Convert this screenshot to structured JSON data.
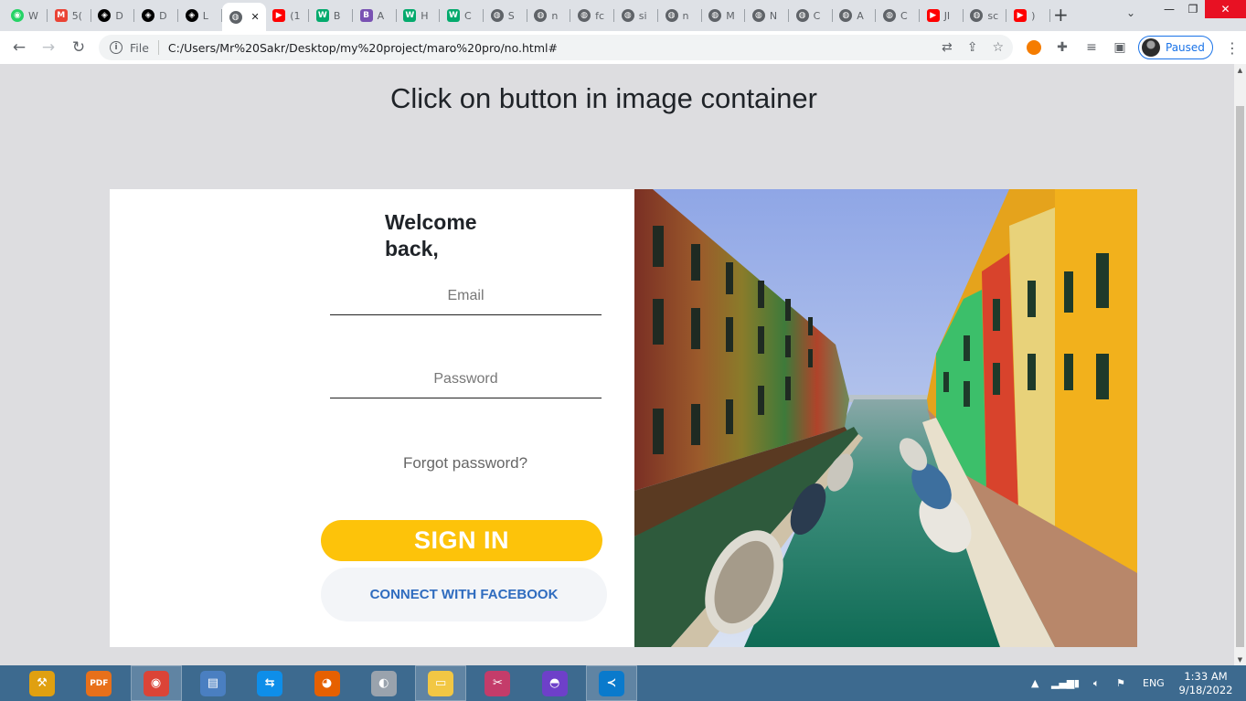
{
  "browser": {
    "tabs": [
      {
        "label": "W",
        "icon": "whatsapp-icon",
        "color": "#25d366"
      },
      {
        "label": "5(",
        "icon": "gmail-icon",
        "color": "#ea4335"
      },
      {
        "label": "D",
        "icon": "codepen-icon",
        "color": "#000000"
      },
      {
        "label": "D",
        "icon": "codepen-icon",
        "color": "#000000"
      },
      {
        "label": "L",
        "icon": "codepen-icon",
        "color": "#000000"
      },
      {
        "label": "",
        "icon": "globe-icon",
        "color": "#5f6368",
        "active": true
      },
      {
        "label": "(1",
        "icon": "youtube-icon",
        "color": "#ff0000"
      },
      {
        "label": "B",
        "icon": "w3schools-icon",
        "color": "#04aa6d"
      },
      {
        "label": "A",
        "icon": "bootstrap-icon",
        "color": "#7952b3"
      },
      {
        "label": "H",
        "icon": "w3schools-icon",
        "color": "#04aa6d"
      },
      {
        "label": "C",
        "icon": "w3schools-icon",
        "color": "#04aa6d"
      },
      {
        "label": "S",
        "icon": "globe-icon",
        "color": "#5f6368"
      },
      {
        "label": "n",
        "icon": "globe-icon",
        "color": "#5f6368"
      },
      {
        "label": "fc",
        "icon": "globe-icon",
        "color": "#5f6368"
      },
      {
        "label": "si",
        "icon": "globe-icon",
        "color": "#5f6368"
      },
      {
        "label": "n",
        "icon": "globe-icon",
        "color": "#5f6368"
      },
      {
        "label": "M",
        "icon": "globe-icon",
        "color": "#5f6368"
      },
      {
        "label": "N",
        "icon": "globe-icon",
        "color": "#5f6368"
      },
      {
        "label": "C",
        "icon": "globe-icon",
        "color": "#5f6368"
      },
      {
        "label": "A",
        "icon": "globe-icon",
        "color": "#5f6368"
      },
      {
        "label": "C",
        "icon": "globe-icon",
        "color": "#5f6368"
      },
      {
        "label": "JI",
        "icon": "youtube-icon",
        "color": "#ff0000"
      },
      {
        "label": "sc",
        "icon": "globe-icon",
        "color": "#5f6368"
      },
      {
        "label": ")",
        "icon": "youtube-icon",
        "color": "#ff0000"
      }
    ],
    "scheme": "File",
    "url": "C:/Users/Mr%20Sakr/Desktop/my%20project/maro%20pro/no.html#",
    "profile_label": "Paused"
  },
  "page": {
    "heading": "Click on button in image container",
    "welcome": "Welcome back,",
    "email_placeholder": "Email",
    "password_placeholder": "Password",
    "forgot": "Forgot password?",
    "signin": "SIGN IN",
    "facebook": "CONNECT WITH FACEBOOK"
  },
  "colors": {
    "accent": "#fdc30a",
    "facebook_text": "#2f6cbf",
    "page_background": "#dddde0"
  },
  "taskbar": {
    "apps": [
      {
        "name": "tools-icon"
      },
      {
        "name": "pdf-icon",
        "label": "PDF"
      },
      {
        "name": "chrome-icon",
        "open": true
      },
      {
        "name": "network-pc-icon"
      },
      {
        "name": "teamviewer-icon"
      },
      {
        "name": "firefox-icon"
      },
      {
        "name": "speaker-app-icon"
      },
      {
        "name": "file-explorer-icon",
        "open": true
      },
      {
        "name": "snipping-tool-icon"
      },
      {
        "name": "github-icon"
      },
      {
        "name": "vscode-icon",
        "open": true
      }
    ],
    "language": "ENG",
    "time": "1:33 AM",
    "date": "9/18/2022"
  }
}
